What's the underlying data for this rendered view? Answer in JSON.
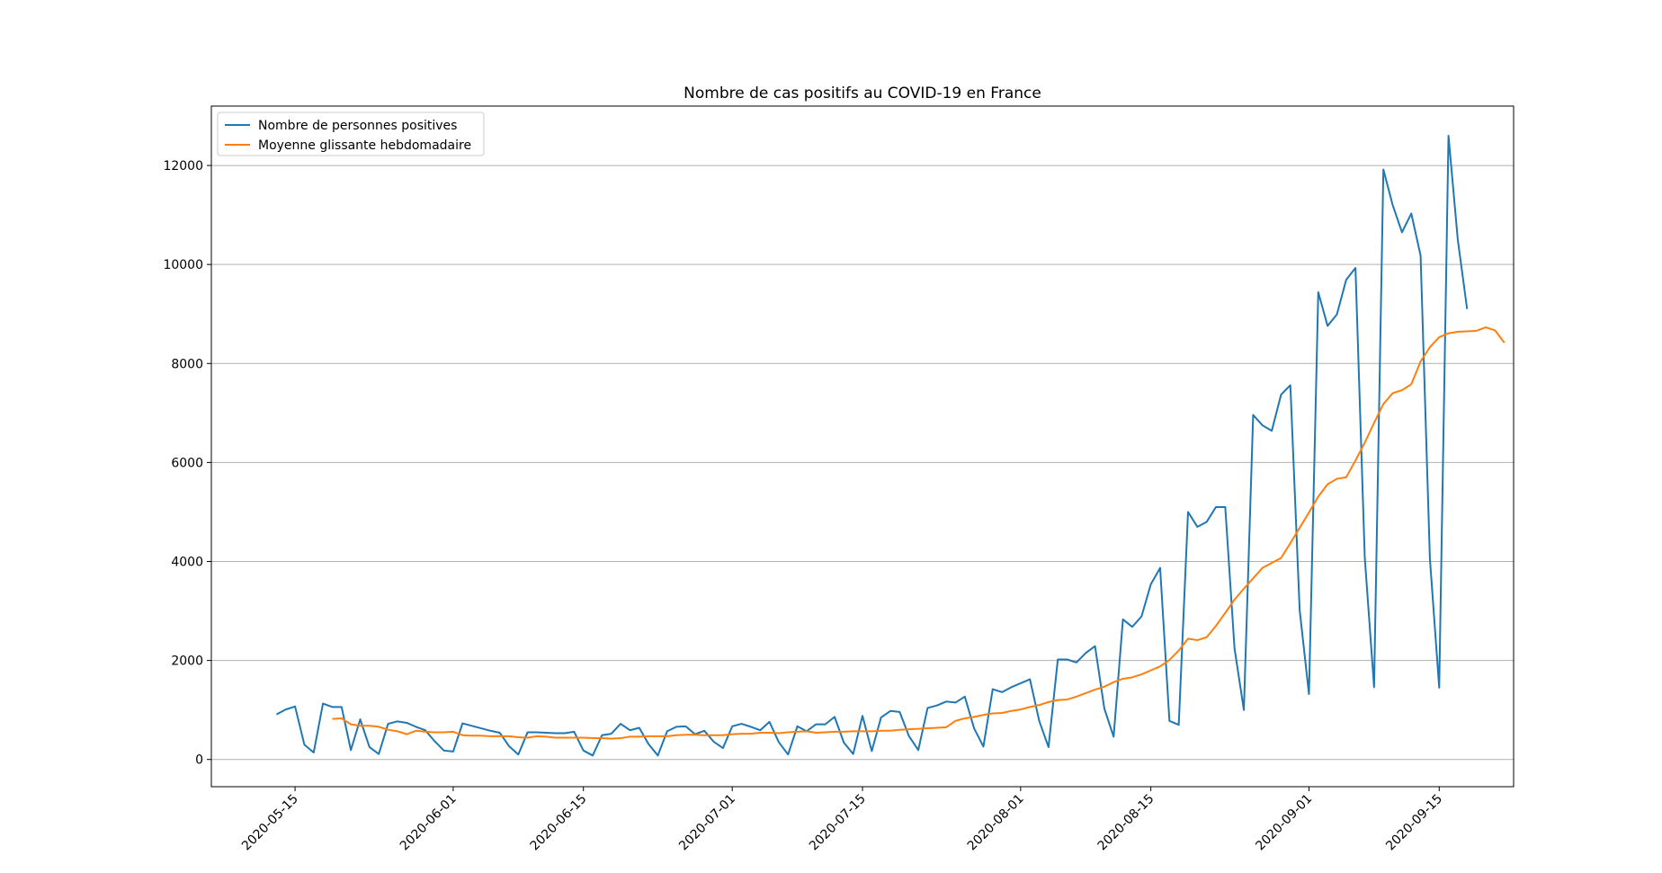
{
  "chart_data": {
    "type": "line",
    "title": "Nombre de cas positifs au COVID-19 en France",
    "xlabel": "",
    "ylabel": "",
    "x_type": "date",
    "x_start": "2020-05-13",
    "x_end": "2020-09-16",
    "xlim": [
      "2020-05-06",
      "2020-09-23"
    ],
    "ylim": [
      -550,
      13200
    ],
    "xticks": [
      "2020-05-15",
      "2020-06-01",
      "2020-06-15",
      "2020-07-01",
      "2020-07-15",
      "2020-08-01",
      "2020-08-15",
      "2020-09-01",
      "2020-09-15"
    ],
    "yticks": [
      0,
      2000,
      4000,
      6000,
      8000,
      10000,
      12000
    ],
    "grid": "y",
    "legend_position": "top-left",
    "series": [
      {
        "name": "Nombre  de personnes positives",
        "color": "#1f77b4",
        "values": [
          910,
          1010,
          1070,
          300,
          140,
          1130,
          1060,
          1060,
          190,
          810,
          250,
          110,
          720,
          770,
          740,
          660,
          590,
          370,
          180,
          160,
          730,
          680,
          630,
          580,
          540,
          270,
          100,
          550,
          550,
          540,
          530,
          530,
          560,
          180,
          80,
          490,
          520,
          720,
          590,
          640,
          310,
          80,
          570,
          660,
          670,
          510,
          580,
          360,
          230,
          670,
          720,
          660,
          590,
          760,
          350,
          100,
          670,
          570,
          710,
          710,
          860,
          340,
          110,
          880,
          170,
          850,
          980,
          960,
          470,
          190,
          1040,
          1090,
          1170,
          1150,
          1270,
          630,
          260,
          1420,
          1360,
          1460,
          1540,
          1620,
          780,
          250,
          2020,
          2020,
          1960,
          2150,
          2290,
          1030,
          460,
          2830,
          2680,
          2890,
          3540,
          3870,
          780,
          700,
          5000,
          4700,
          4800,
          5100,
          5100,
          2240,
          1000,
          6960,
          6750,
          6640,
          7370,
          7560,
          3020,
          1320,
          9440,
          8760,
          8990,
          9690,
          9930,
          4080,
          1460,
          11920,
          11200,
          10650,
          11030,
          10180,
          4060,
          1450,
          12600,
          10500,
          9100
        ]
      },
      {
        "name": "Moyenne glissante hebdomadaire",
        "color": "#ff7f0e",
        "values": [
          null,
          null,
          null,
          null,
          null,
          null,
          820,
          830,
          710,
          680,
          680,
          660,
          600,
          570,
          510,
          580,
          560,
          550,
          550,
          560,
          490,
          480,
          480,
          470,
          470,
          470,
          450,
          440,
          470,
          460,
          440,
          440,
          440,
          440,
          430,
          430,
          420,
          430,
          460,
          460,
          470,
          470,
          470,
          490,
          500,
          500,
          490,
          490,
          490,
          510,
          520,
          520,
          540,
          540,
          530,
          550,
          560,
          570,
          540,
          550,
          560,
          560,
          570,
          570,
          570,
          580,
          580,
          600,
          610,
          620,
          630,
          640,
          650,
          780,
          830,
          860,
          900,
          930,
          940,
          980,
          1010,
          1060,
          1100,
          1160,
          1200,
          1210,
          1270,
          1340,
          1410,
          1470,
          1560,
          1630,
          1660,
          1720,
          1800,
          1880,
          2010,
          2200,
          2440,
          2410,
          2470,
          2700,
          2960,
          3230,
          3450,
          3660,
          3870,
          3970,
          4070,
          4370,
          4680,
          4990,
          5310,
          5560,
          5670,
          5700,
          6040,
          6400,
          6800,
          7180,
          7400,
          7460,
          7580,
          8040,
          8330,
          8530,
          8610,
          8640,
          8650,
          8660,
          8730,
          8670,
          8420
        ]
      }
    ]
  }
}
